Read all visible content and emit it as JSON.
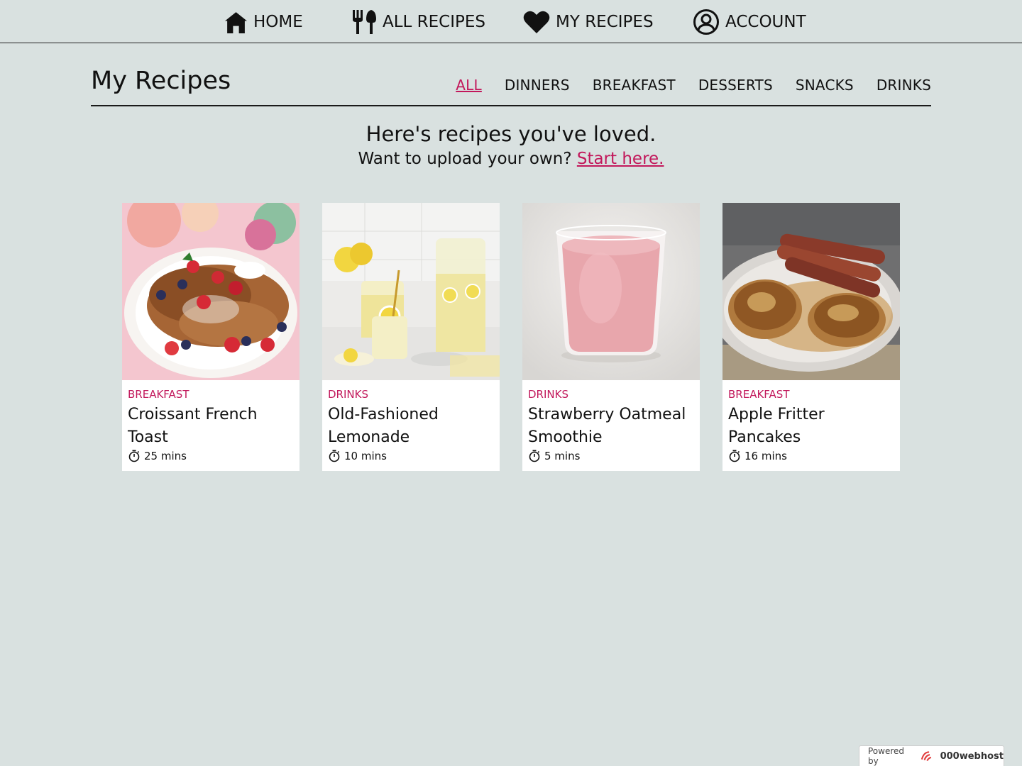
{
  "nav": {
    "home": "HOME",
    "all_recipes": "ALL RECIPES",
    "my_recipes": "MY RECIPES",
    "account": "ACCOUNT"
  },
  "header": {
    "title": "My Recipes",
    "tabs": [
      "ALL",
      "DINNERS",
      "BREAKFAST",
      "DESSERTS",
      "SNACKS",
      "DRINKS"
    ],
    "active_tab": "ALL"
  },
  "intro": {
    "heading": "Here's recipes you've loved.",
    "sub_text": "Want to upload your own?",
    "link_text": "Start here."
  },
  "recipes": [
    {
      "category": "BREAKFAST",
      "title": "Croissant French Toast",
      "time": "25 mins",
      "image": "croissant-french-toast-photo"
    },
    {
      "category": "DRINKS",
      "title": "Old-Fashioned Lemonade",
      "time": "10 mins",
      "image": "lemonade-photo"
    },
    {
      "category": "DRINKS",
      "title": "Strawberry Oatmeal Smoothie",
      "time": "5 mins",
      "image": "strawberry-smoothie-photo"
    },
    {
      "category": "BREAKFAST",
      "title": "Apple Fritter Pancakes",
      "time": "16 mins",
      "image": "apple-fritter-pancakes-photo"
    }
  ],
  "footer_badge": {
    "label": "Powered by",
    "brand": "000webhost"
  },
  "colors": {
    "background": "#d9e1e0",
    "accent": "#c2185b",
    "card": "#ffffff"
  },
  "icons": [
    "home-icon",
    "utensils-icon",
    "heart-icon",
    "user-circle-icon",
    "stopwatch-icon",
    "000webhost-logo-icon"
  ]
}
